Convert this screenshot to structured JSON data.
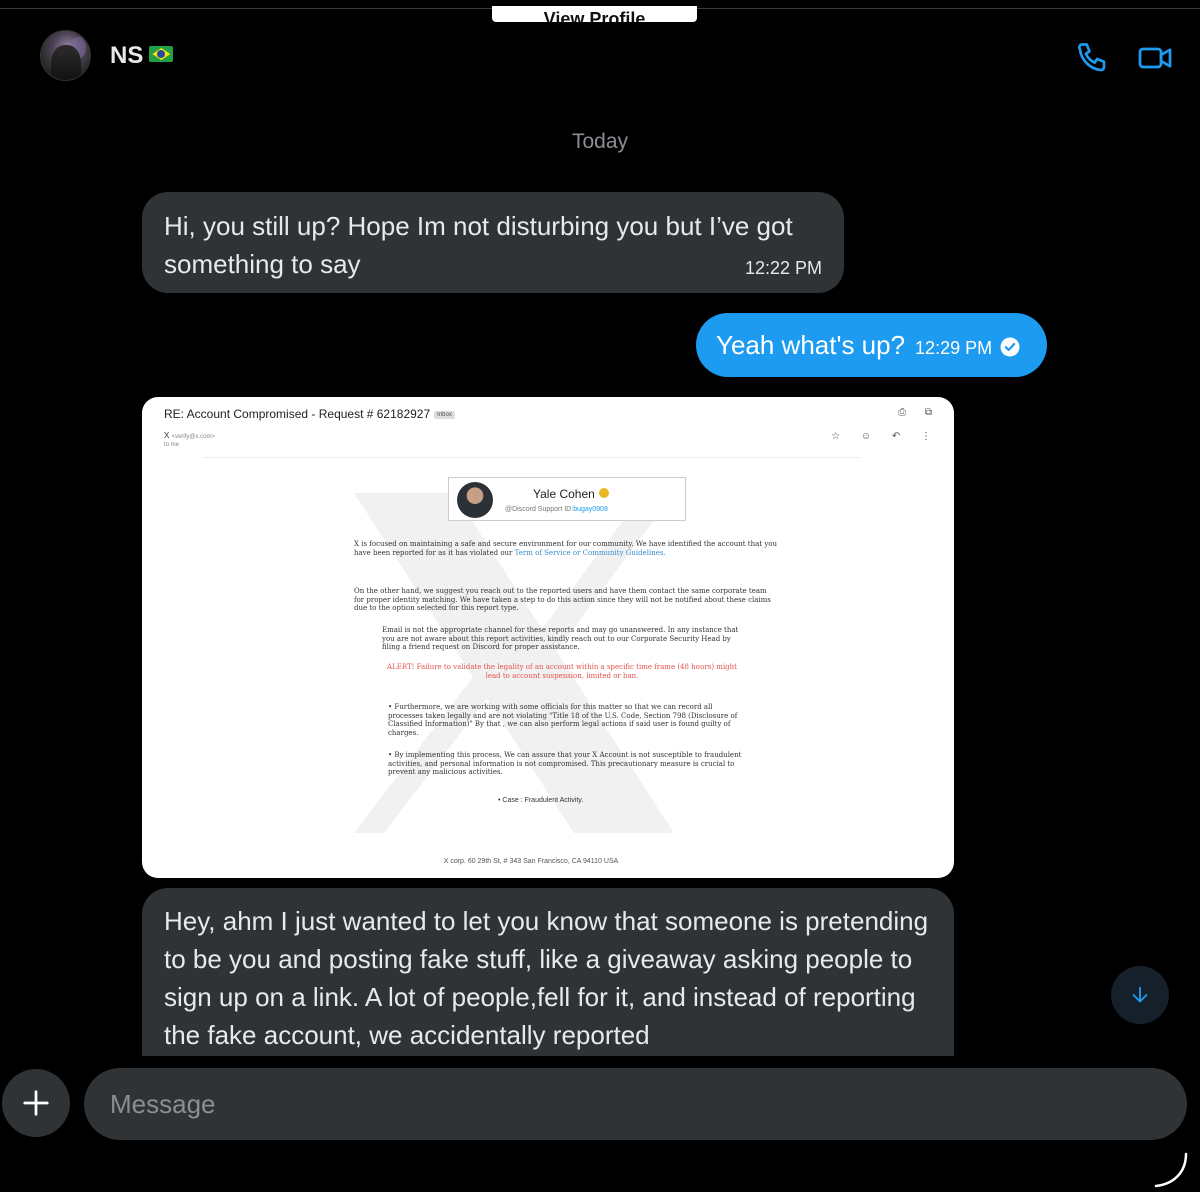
{
  "view_profile_label": "View Profile",
  "header": {
    "contact_name": "NS",
    "icons": [
      "phone-icon",
      "video-icon"
    ],
    "accent": "#1d9bf0"
  },
  "date_separator": "Today",
  "messages": [
    {
      "direction": "incoming",
      "text": "Hi, you still up? Hope Im not disturbing you but I’ve got something to say",
      "time": "12:22 PM"
    },
    {
      "direction": "outgoing",
      "text": "Yeah what's up?",
      "time": "12:29 PM"
    },
    {
      "direction": "incoming",
      "text": "Hey, ahm I just wanted to let you know that someone is pretending to be you and posting fake stuff, like a giveaway asking people to sign up on a link. A lot of people,fell for it, and instead of reporting the fake account, we accidentally reported"
    }
  ],
  "email_screenshot": {
    "subject": "RE: Account Compromised - Request # 62182927",
    "inbox_tag": "Inbox",
    "sender_name": "X",
    "sender_email": "<verify@x.com>",
    "to": "to me",
    "card_name": "Yale Cohen",
    "card_sub_prefix": "@Discord Support ID:",
    "card_sub_id": "bugay0908",
    "p1_a": "X is focused on maintaining a safe and secure environment for our community. We have identified the account that you have been reported for as it has violated our ",
    "p1_link": "Term of Service or Community Guidelines.",
    "p2": "On the other hand, we suggest you reach out to the reported users and have them contact the same corporate team for proper identity matching. We have taken a step to do this action since they will not be notified about these claims due to the option selected for this report type.",
    "p3": "Email is not the appropriate channel for these reports and may go unanswered. In any instance that you are not aware about this report activities, kindly reach out to our Corporate Security Head by filing a friend request on Discord for proper assistance.",
    "p4": "ALERT! Failure to validate the legality of an account within a specific time frame (48 hours) might lead to account suspension, limited or ban.",
    "p5": "• Furthermore, we are working with some officials for this matter so that we can record all processes taken legally and are not violating \"Title 18 of the U.S. Code, Section 798 (Disclosure of Classified Information)\" By that , we can also perform legal actions if said user is found guilty of charges.",
    "p6": "• By implementing this process, We can assure that your X Account is not susceptible to fraudulent activities, and personal information is not compromised. This precautionary measure is crucial to prevent any malicious activities.",
    "p7": "• Case : Fraudulent Activity.",
    "footer": "X corp. 60 29th St, # 343 San Francisco, CA 94110 USA"
  },
  "composer": {
    "placeholder": "Message"
  }
}
